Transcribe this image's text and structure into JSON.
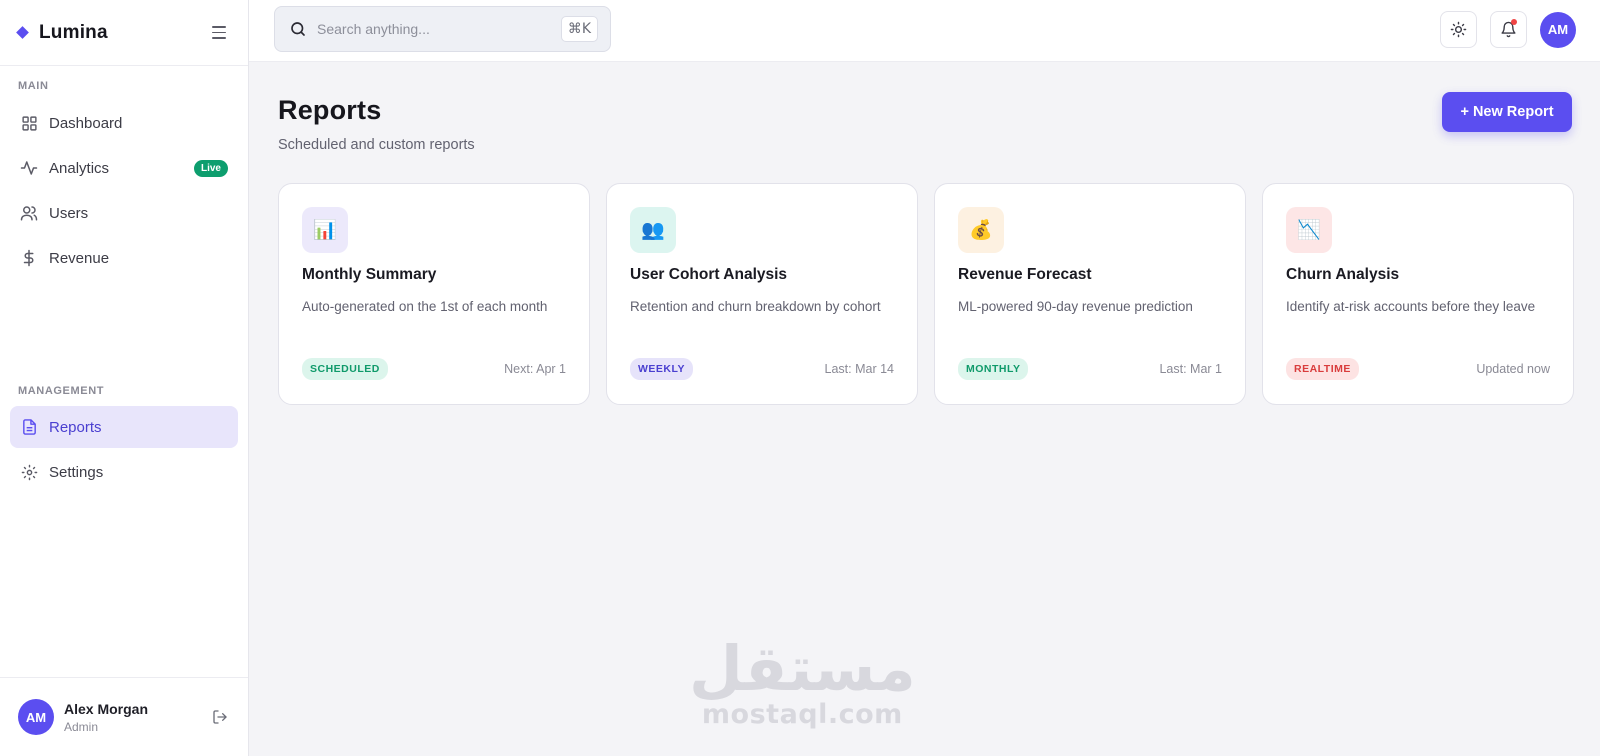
{
  "brand": {
    "name": "Lumina"
  },
  "sidebar": {
    "main_label": "MAIN",
    "main_items": [
      {
        "label": "Dashboard",
        "icon": "grid-icon"
      },
      {
        "label": "Analytics",
        "icon": "activity-icon",
        "badge": "Live"
      },
      {
        "label": "Users",
        "icon": "users-icon"
      },
      {
        "label": "Revenue",
        "icon": "dollar-icon"
      }
    ],
    "management_label": "MANAGEMENT",
    "management_items": [
      {
        "label": "Reports",
        "icon": "file-icon",
        "active": true
      },
      {
        "label": "Settings",
        "icon": "gear-icon"
      }
    ],
    "user": {
      "initials": "AM",
      "name": "Alex Morgan",
      "role": "Admin"
    }
  },
  "topbar": {
    "search_placeholder": "Search anything...",
    "shortcut": "⌘K",
    "avatar_initials": "AM"
  },
  "page": {
    "title": "Reports",
    "subtitle": "Scheduled and custom reports",
    "new_button": "+ New Report"
  },
  "cards": [
    {
      "icon": "📊",
      "icon_name": "bar-chart-icon",
      "icon_bg": "#ece9fb",
      "title": "Monthly Summary",
      "description": "Auto-generated on the 1st of each month",
      "tag": "SCHEDULED",
      "tag_color": "#0f9a6a",
      "tag_bg": "#dcf5ec",
      "meta": "Next: Apr 1"
    },
    {
      "icon": "👥",
      "icon_name": "people-icon",
      "icon_bg": "#dcf5f0",
      "title": "User Cohort Analysis",
      "description": "Retention and churn breakdown by cohort",
      "tag": "WEEKLY",
      "tag_color": "#4a3fd0",
      "tag_bg": "#e6e3fa",
      "meta": "Last: Mar 14"
    },
    {
      "icon": "💰",
      "icon_name": "money-bag-icon",
      "icon_bg": "#fdf1e1",
      "title": "Revenue Forecast",
      "description": "ML-powered 90-day revenue prediction",
      "tag": "MONTHLY",
      "tag_color": "#0f9a6a",
      "tag_bg": "#dcf5ec",
      "meta": "Last: Mar 1"
    },
    {
      "icon": "📉",
      "icon_name": "trend-down-icon",
      "icon_bg": "#fde6e6",
      "title": "Churn Analysis",
      "description": "Identify at-risk accounts before they leave",
      "tag": "REALTIME",
      "tag_color": "#d93c3c",
      "tag_bg": "#fde3e3",
      "meta": "Updated now"
    }
  ],
  "watermark": {
    "arabic": "مستقل",
    "latin": "mostaql.com"
  },
  "colors": {
    "accent": "#5b4ef0",
    "live": "#0d9e6e"
  }
}
